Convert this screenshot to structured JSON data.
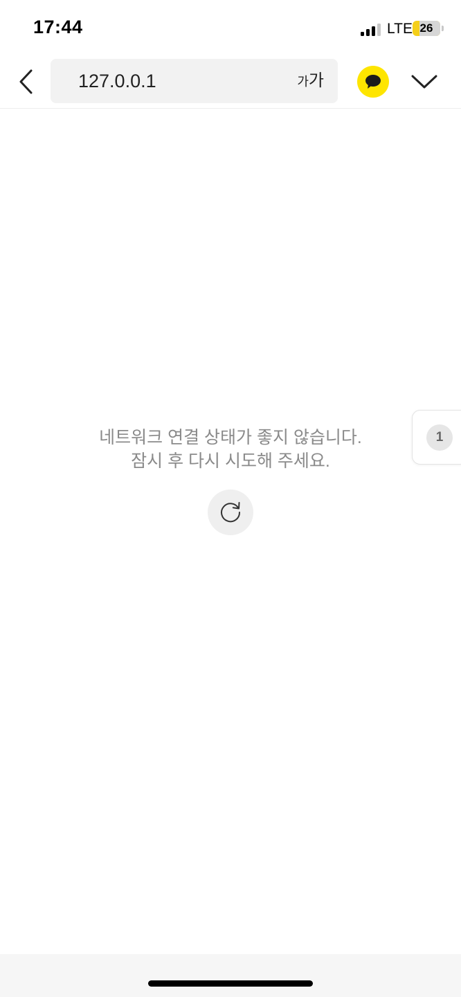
{
  "status_bar": {
    "time": "17:44",
    "network": "LTE",
    "battery_percent": "26",
    "battery_level": 0.26,
    "signal_bars_active": 3,
    "signal_bars_total": 4
  },
  "nav": {
    "url": "127.0.0.1",
    "text_size_small": "가",
    "text_size_large": "가",
    "back_icon": "chevron-left-icon",
    "kakaotalk_icon": "speech-bubble-icon",
    "menu_icon": "chevron-down-icon"
  },
  "error": {
    "line1": "네트워크 연결 상태가 좋지 않습니다.",
    "line2": "잠시 후 다시 시도해 주세요.",
    "retry_icon": "refresh-icon"
  },
  "tab_counter": {
    "count": "1"
  },
  "colors": {
    "kakao_yellow": "#fee500",
    "battery_yellow": "#f5cf1a",
    "message_gray": "#8a8a8a",
    "url_bar_bg": "#f2f2f2"
  }
}
